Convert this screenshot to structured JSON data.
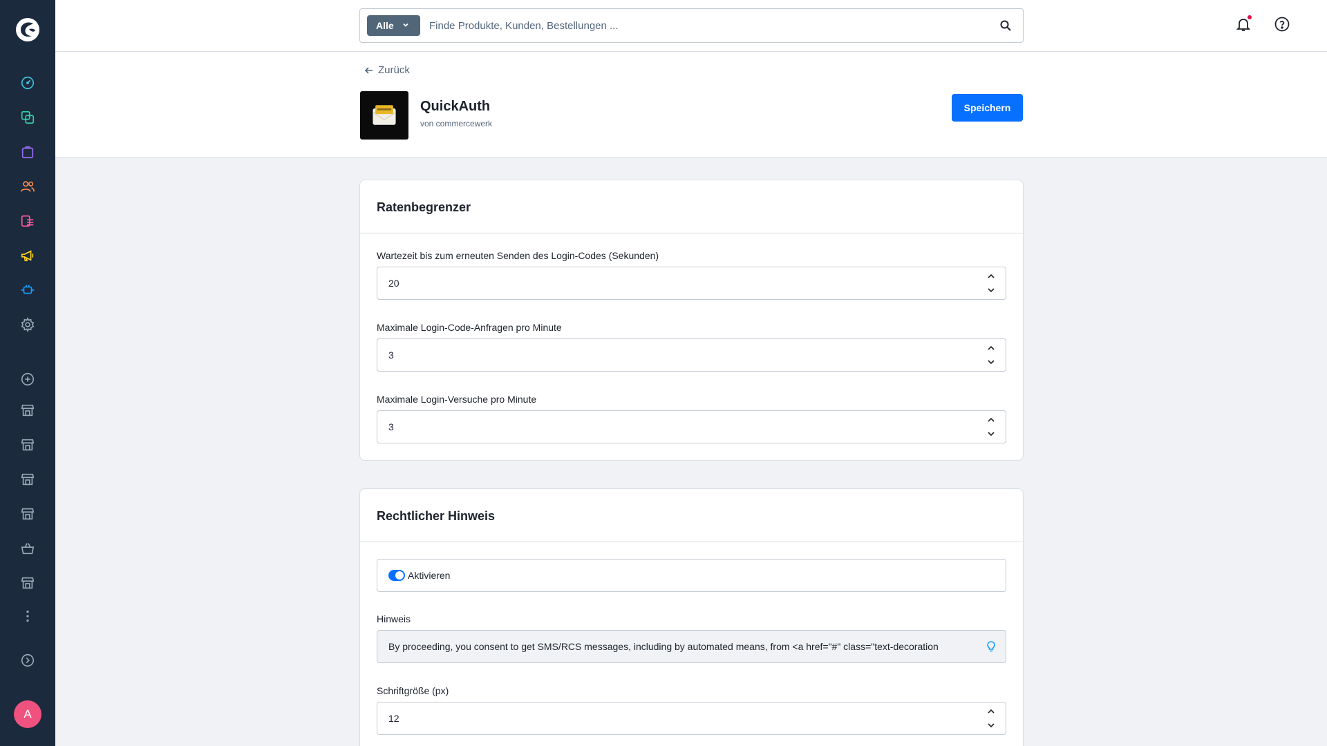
{
  "search": {
    "scope_label": "Alle",
    "placeholder": "Finde Produkte, Kunden, Bestellungen ..."
  },
  "header": {
    "back_label": "Zurück",
    "app_name": "QuickAuth",
    "app_vendor": "von commercewerk",
    "save_label": "Speichern"
  },
  "rate_limiter": {
    "title": "Ratenbegrenzer",
    "fields": [
      {
        "label": "Wartezeit bis zum erneuten Senden des Login-Codes (Sekunden)",
        "value": "20"
      },
      {
        "label": "Maximale Login-Code-Anfragen pro Minute",
        "value": "3"
      },
      {
        "label": "Maximale Login-Versuche pro Minute",
        "value": "3"
      }
    ]
  },
  "legal_notice": {
    "title": "Rechtlicher Hinweis",
    "toggle_label": "Aktivieren",
    "toggle_on": true,
    "notice_label": "Hinweis",
    "notice_value": "By proceeding, you consent to get SMS/RCS messages, including by automated means, from <a href=\"#\" class=\"text-decoration",
    "font_size_label": "Schriftgröße (px)",
    "font_size_value": "12"
  },
  "user": {
    "avatar_initial": "A"
  },
  "colors": {
    "sidebar": "#1b2a3d",
    "primary": "#0870ff",
    "avatar": "#f0527f"
  }
}
